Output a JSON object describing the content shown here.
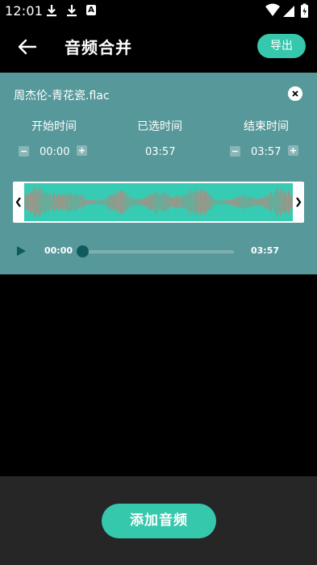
{
  "status_bar": {
    "time": "12:01",
    "notification_letter": "A"
  },
  "app_bar": {
    "title": "音频合并",
    "export_label": "导出"
  },
  "audio_item": {
    "file_name": "周杰伦-青花瓷.flac",
    "start_label": "开始时间",
    "selected_label": "已选时间",
    "end_label": "结束时间",
    "start_value": "00:00",
    "selected_value": "03:57",
    "end_value": "03:57",
    "player": {
      "current": "00:00",
      "duration": "03:57",
      "progress": 0.0
    }
  },
  "bottom": {
    "add_label": "添加音频"
  },
  "colors": {
    "accent": "#35c8ad",
    "card": "#57989a",
    "wave_fill": "#36cbb3",
    "wave_lines": "#c77b72"
  },
  "icons": [
    "download-icon",
    "download-icon",
    "a-notification-icon",
    "wifi-icon",
    "signal-icon",
    "battery-icon",
    "back-arrow-icon",
    "close-icon",
    "minus-icon",
    "plus-icon",
    "play-icon",
    "chevron-left-icon",
    "chevron-right-icon"
  ]
}
